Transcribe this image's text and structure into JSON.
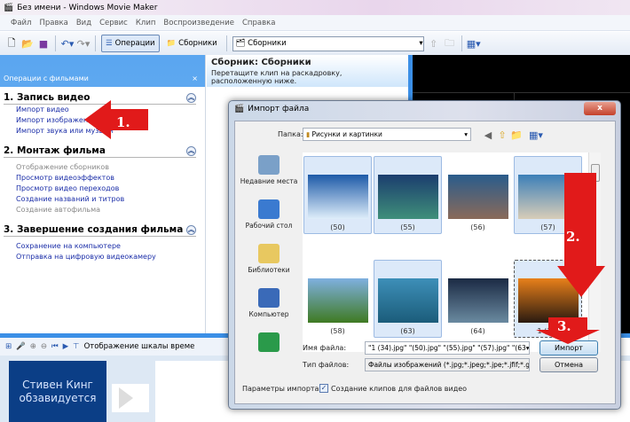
{
  "window": {
    "title": "Без имени - Windows Movie Maker"
  },
  "menu": [
    "Файл",
    "Правка",
    "Вид",
    "Сервис",
    "Клип",
    "Воспроизведение",
    "Справка"
  ],
  "toolbar": {
    "operations_label": "Операции",
    "collections_label": "Сборники",
    "collection_select": "Сборники"
  },
  "left_panel": {
    "header": "Операции с фильмами",
    "close": "×",
    "sections": [
      {
        "title": "1. Запись видео",
        "items": [
          {
            "label": "Импорт видео",
            "enabled": true
          },
          {
            "label": "Импорт изображений",
            "enabled": true
          },
          {
            "label": "Импорт звука или музыки",
            "enabled": true
          }
        ]
      },
      {
        "title": "2. Монтаж фильма",
        "items": [
          {
            "label": "Отображение сборников",
            "enabled": false
          },
          {
            "label": "Просмотр видеоэффектов",
            "enabled": true
          },
          {
            "label": "Просмотр видео переходов",
            "enabled": true
          },
          {
            "label": "Создание названий и титров",
            "enabled": true
          },
          {
            "label": "Создание автофильма",
            "enabled": false
          }
        ]
      },
      {
        "title": "3. Завершение создания фильма",
        "items": [
          {
            "label": "Сохранение на компьютере",
            "enabled": true
          },
          {
            "label": "Отправка на цифровую видеокамеру",
            "enabled": true
          }
        ]
      }
    ]
  },
  "collection": {
    "title": "Сборник: Сборники",
    "hint": "Перетащите клип на раскадровку, расположенную ниже."
  },
  "timeline": {
    "toggle_label": "Отображение шкалы време",
    "clip_title": "Стивен Кинг обзавидуется"
  },
  "dialog": {
    "title": "Импорт файла",
    "close": "x",
    "folder_label": "Папка:",
    "folder_value": "Рисунки и картинки",
    "places": [
      "Недавние места",
      "Рабочий стол",
      "Библиотеки",
      "Компьютер",
      ""
    ],
    "files": [
      {
        "name": "(50)",
        "selected": true,
        "colors": [
          "#1d5aa8",
          "#dfeefa"
        ]
      },
      {
        "name": "(55)",
        "selected": true,
        "colors": [
          "#1b3d6e",
          "#3f8f7a"
        ]
      },
      {
        "name": "(56)",
        "selected": false,
        "colors": [
          "#2a5c8c",
          "#8a6a5a"
        ]
      },
      {
        "name": "(57)",
        "selected": true,
        "colors": [
          "#3c7fb8",
          "#d8cdb8"
        ]
      },
      {
        "name": "(58)",
        "selected": false,
        "colors": [
          "#7fb0e0",
          "#3f7a22"
        ]
      },
      {
        "name": "(63)",
        "selected": true,
        "colors": [
          "#3d8fb8",
          "#1b5c7a"
        ]
      },
      {
        "name": "(64)",
        "selected": false,
        "colors": [
          "#1b2a44",
          "#6a8aa0"
        ]
      },
      {
        "name": "1 (34)",
        "selected": true,
        "focused": true,
        "colors": [
          "#e8801a",
          "#2a1a10"
        ]
      }
    ],
    "filename_label": "Имя файла:",
    "filename_value": "\"1 (34).jpg\" \"(50).jpg\" \"(55).jpg\" \"(57).jpg\" \"(63",
    "filetype_label": "Тип файлов:",
    "filetype_value": "Файлы изображений (*.jpg;*.jpeg;*.jpe;*.jfif;*.g",
    "import_button": "Импорт",
    "cancel_button": "Отмена",
    "options_label": "Параметры импорта:",
    "create_clips_label": "Создание клипов для файлов видео",
    "create_clips_checked": true
  },
  "annotations": {
    "step1": "1.",
    "step2": "2.",
    "step3": "3.",
    "color": "#e11a1a"
  }
}
